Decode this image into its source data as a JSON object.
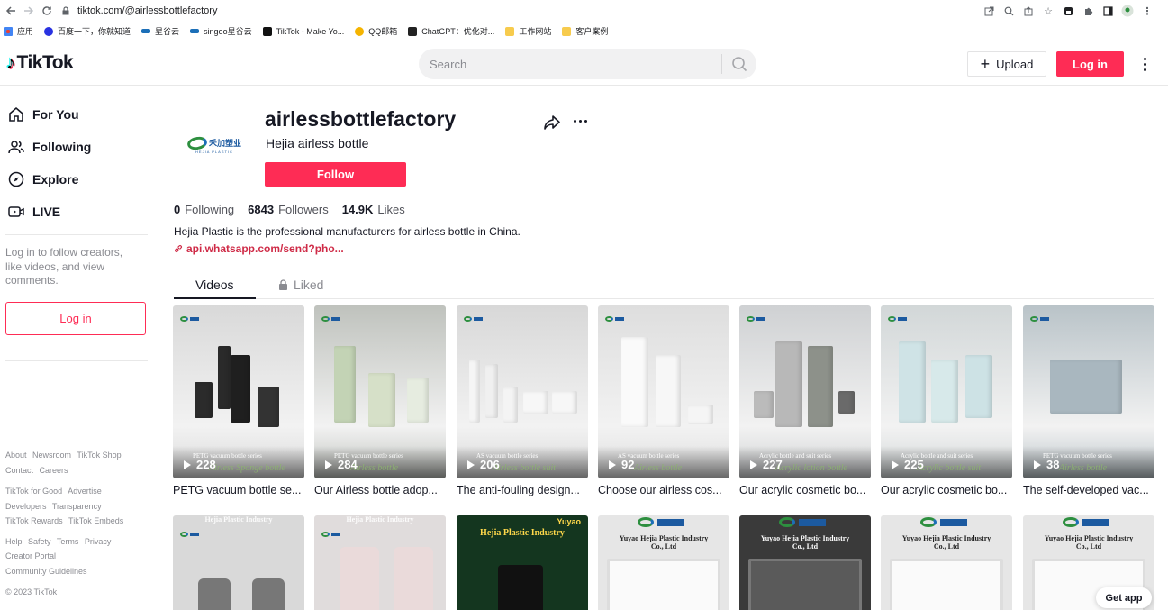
{
  "browser": {
    "url": "tiktok.com/@airlessbottlefactory",
    "bookmarks": [
      {
        "label": "应用",
        "icon": "apps-grid-icon",
        "color": "#e94235"
      },
      {
        "label": "百度一下，你就知道",
        "icon": "baidu-icon",
        "color": "#2932e1"
      },
      {
        "label": "星谷云",
        "icon": "xingguyun-icon",
        "color": "#1c6fb8"
      },
      {
        "label": "singoo星谷云",
        "icon": "singoo-icon",
        "color": "#1c6fb8"
      },
      {
        "label": "TikTok - Make Yo...",
        "icon": "tiktok-icon",
        "color": "#111111"
      },
      {
        "label": "QQ邮箱",
        "icon": "qqmail-icon",
        "color": "#f5b400"
      },
      {
        "label": "ChatGPT：优化对...",
        "icon": "chatgpt-icon",
        "color": "#222222"
      },
      {
        "label": "工作网站",
        "icon": "folder-icon",
        "color": "#f7cb4d"
      },
      {
        "label": "客户案例",
        "icon": "folder-icon",
        "color": "#f7cb4d"
      }
    ]
  },
  "header": {
    "logo_text": "TikTok",
    "search_placeholder": "Search",
    "upload_label": "Upload",
    "login_label": "Log in"
  },
  "sidebar": {
    "nav": [
      {
        "label": "For You",
        "icon": "home-icon"
      },
      {
        "label": "Following",
        "icon": "users-icon"
      },
      {
        "label": "Explore",
        "icon": "compass-icon"
      },
      {
        "label": "LIVE",
        "icon": "live-icon"
      }
    ],
    "login_message": "Log in to follow creators, like videos, and view comments.",
    "login_button": "Log in",
    "footer": [
      [
        "About",
        "Newsroom",
        "TikTok Shop"
      ],
      [
        "Contact",
        "Careers"
      ],
      [
        "TikTok for Good",
        "Advertise"
      ],
      [
        "Developers",
        "Transparency"
      ],
      [
        "TikTok Rewards",
        "TikTok Embeds"
      ],
      [
        "Help",
        "Safety",
        "Terms",
        "Privacy"
      ],
      [
        "Creator Portal"
      ],
      [
        "Community Guidelines"
      ],
      [
        "© 2023 TikTok"
      ]
    ]
  },
  "profile": {
    "avatar_brand": "禾加塑业",
    "avatar_sub": "HEJIA PLASTIC",
    "username": "airlessbottlefactory",
    "nickname": "Hejia airless bottle",
    "follow_label": "Follow",
    "following_count": "0",
    "following_label": "Following",
    "followers_count": "6843",
    "followers_label": "Followers",
    "likes_count": "14.9K",
    "likes_label": "Likes",
    "bio": "Hejia Plastic is the professional manufacturers for airless bottle in China.",
    "link": "api.whatsapp.com/send?pho..."
  },
  "tabs": {
    "videos": "Videos",
    "liked": "Liked"
  },
  "videos_row1": [
    {
      "views": "228",
      "caption": "PETG vacuum bottle se...",
      "overlay": "PETG vacuum bottle series",
      "script": "Airless Sponge bottle",
      "bg": "#d9d9d9"
    },
    {
      "views": "284",
      "caption": "Our Airless bottle adop...",
      "overlay": "PETG vacuum bottle series",
      "script": "Airless bottle",
      "bg": "#bfc2bd"
    },
    {
      "views": "206",
      "caption": "The anti-fouling design...",
      "overlay": "AS vacuum bottle series",
      "script": "Airless bottle suit",
      "bg": "#d8d8d8"
    },
    {
      "views": "92",
      "caption": "Choose our airless cos...",
      "overlay": "AS vacuum bottle series",
      "script": "Airless bottle",
      "bg": "#dedede"
    },
    {
      "views": "227",
      "caption": "Our acrylic cosmetic bo...",
      "overlay": "Acrylic bottle and suit series",
      "script": "Acrylic lotion bottle",
      "bg": "#cfd1d3"
    },
    {
      "views": "225",
      "caption": "Our acrylic cosmetic bo...",
      "overlay": "Acrylic bottle and suit series",
      "script": "Acrylic bottle suit",
      "bg": "#d2d7d8"
    },
    {
      "views": "38",
      "caption": "The self-developed vac...",
      "overlay": "PETG vacuum bottle series",
      "script": "Airless bottle",
      "bg": "#b9c3c8"
    }
  ],
  "videos_row2": [
    {
      "banner": "Hejia Plastic Industry",
      "bg": "#d9d9d9"
    },
    {
      "banner": "Hejia Plastic Industry",
      "bg": "#e0dcdc"
    },
    {
      "banner": "Hejia Plastic Industry",
      "brand": "Yuyao",
      "bg": "#14361f"
    },
    {
      "banner": "Yuyao Hejia Plastic Industry Co., Ltd",
      "bg": "#e6e6e6"
    },
    {
      "banner": "Yuyao Hejia Plastic Industry Co., Ltd",
      "bg": "#3a3a3a"
    },
    {
      "banner": "Yuyao Hejia Plastic Industry Co., Ltd",
      "bg": "#e6e6e6"
    },
    {
      "banner": "Yuyao Hejia Plastic Industry Co., Ltd",
      "bg": "#e6e6e6"
    }
  ],
  "get_app": "Get app",
  "colors": {
    "accent": "#fe2c55",
    "link": "#cf2b47",
    "muted": "#8a8b91",
    "text": "#161823"
  }
}
